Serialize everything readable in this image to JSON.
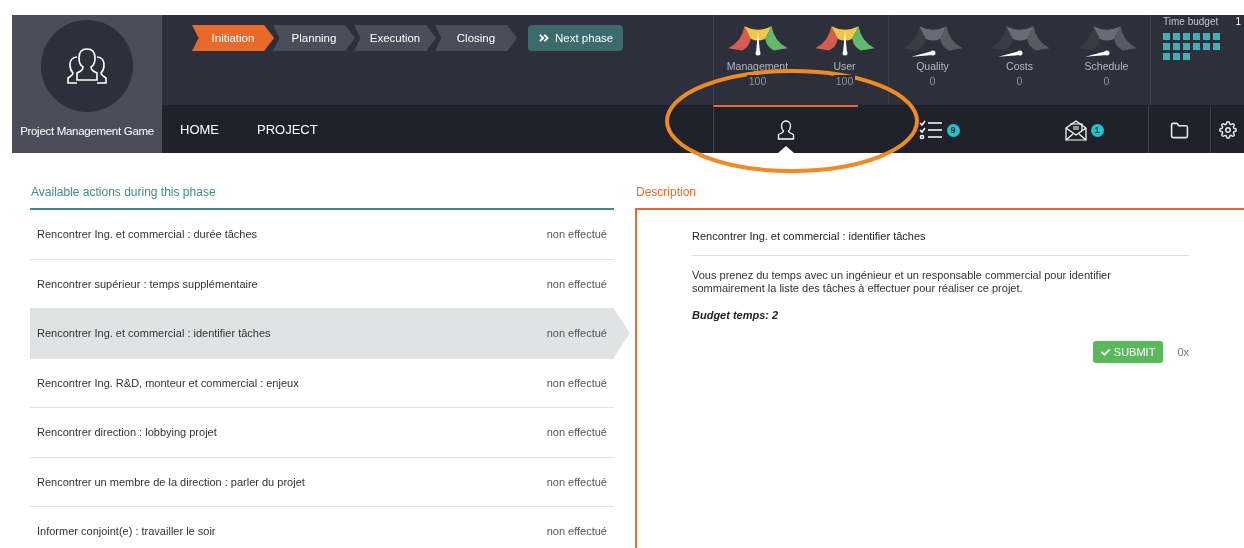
{
  "app": {
    "title": "Project Management Game"
  },
  "phases": [
    {
      "label": "Initiation",
      "selected": true
    },
    {
      "label": "Planning",
      "selected": false
    },
    {
      "label": "Execution",
      "selected": false
    },
    {
      "label": "Closing",
      "selected": false
    }
  ],
  "next_phase": {
    "label": "Next phase"
  },
  "gauges": [
    {
      "label": "Management",
      "value": "100",
      "active": true
    },
    {
      "label": "User",
      "value": "100",
      "active": true
    },
    {
      "label": "Quality",
      "value": "0",
      "active": false
    },
    {
      "label": "Costs",
      "value": "0",
      "active": false
    },
    {
      "label": "Schedule",
      "value": "0",
      "active": false
    }
  ],
  "time_budget": {
    "label": "Time budget",
    "value": "1",
    "blocks": [
      {
        "filled": true
      },
      {
        "filled": true
      },
      {
        "filled": true
      },
      {
        "filled": true
      },
      {
        "filled": true
      },
      {
        "filled": true
      },
      {
        "filled": true
      },
      {
        "filled": true
      },
      {
        "filled": true
      },
      {
        "filled": true
      },
      {
        "filled": true
      },
      {
        "filled": true
      },
      {
        "filled": true
      },
      {
        "filled": true
      },
      {
        "filled": true
      }
    ]
  },
  "nav": [
    {
      "label": "HOME"
    },
    {
      "label": "PROJECT"
    }
  ],
  "tool_tabs": [
    {
      "kind": "people",
      "selected": true
    },
    {
      "kind": "tasks",
      "selected": false,
      "badge": "9"
    },
    {
      "kind": "mail",
      "selected": false,
      "badge": "1"
    },
    {
      "kind": "folder",
      "selected": false
    },
    {
      "kind": "settings",
      "selected": false
    }
  ],
  "actions": {
    "title": "Available actions during this phase",
    "rows": [
      {
        "name": "Rencontrer Ing. et commercial : durée tâches",
        "status": "non effectué",
        "selected": false
      },
      {
        "name": "Rencontrer supérieur : temps supplémentaire",
        "status": "non effectué",
        "selected": false
      },
      {
        "name": "Rencontrer Ing. et commercial : identifier tâches",
        "status": "non effectué",
        "selected": true
      },
      {
        "name": "Rencontrer Ing. R&D, monteur et commercial : enjeux",
        "status": "non effectué",
        "selected": false
      },
      {
        "name": "Rencontrer direction : lobbying projet",
        "status": "non effectué",
        "selected": false
      },
      {
        "name": "Rencontrer un membre de la direction : parler du projet",
        "status": "non effectué",
        "selected": false
      },
      {
        "name": "Informer conjoint(e) : travailler le soir",
        "status": "non effectué",
        "selected": false
      }
    ]
  },
  "description": {
    "title": "Description",
    "heading": "Rencontrer Ing. et commercial : identifier tâches",
    "text": "Vous prenez du temps avec un ingénieur et un responsable commercial pour identifier sommairement la liste des tâches à effectuer pour réaliser ce projet.",
    "budget": "Budget temps: 2",
    "submit": "SUBMIT",
    "count": "0x"
  }
}
